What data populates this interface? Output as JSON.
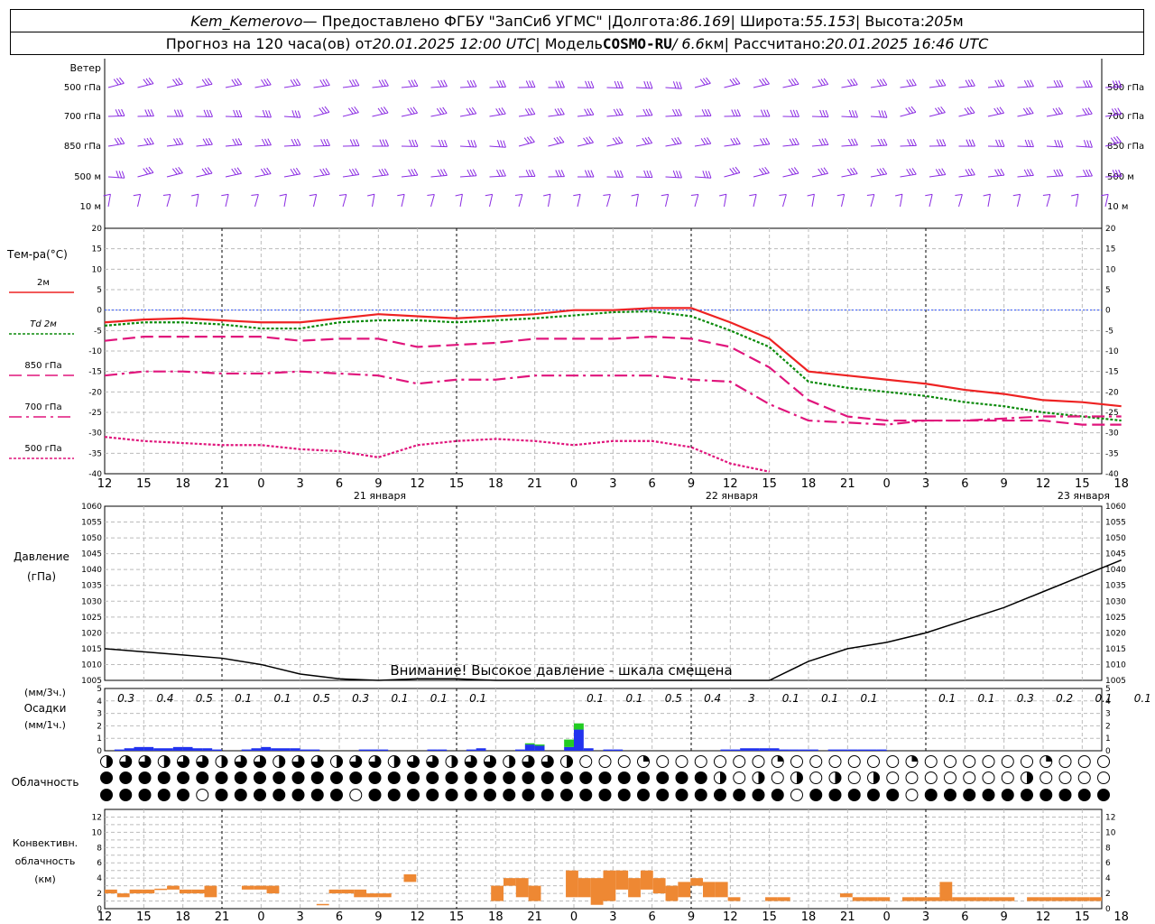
{
  "header": {
    "station": "Kem_Kemerovo",
    "provider": " — Предоставлено ФГБУ \"ЗапСиб УГМС\" | ",
    "lon_label": "Долгота: ",
    "lon": "86.169",
    "lat_label": " | Широта: ",
    "lat": "55.153",
    "alt_label": " | Высота: ",
    "alt": "205",
    "alt_unit": "м",
    "forecast_label": "Прогноз на 120 часа(ов) от ",
    "forecast_from": "20.01.2025 12:00 UTC",
    "model_label": " | Модель ",
    "model": "COSMO-RU",
    "res": " / 6.6",
    "res_unit": "км",
    "calc_label": " | Рассчитано: ",
    "calc": "20.01.2025 16:46 UTC"
  },
  "wind": {
    "title": "Ветер",
    "levels": [
      "500 гПа",
      "700 гПа",
      "850 гПа",
      "500 м",
      "10  м"
    ],
    "barb_color": "#8a2be2"
  },
  "temperature": {
    "title": "Тем-ра(°C)",
    "legend": [
      "2м",
      "Td  2м",
      "850 гПа",
      "700 гПа",
      "500 гПа"
    ],
    "colors": {
      "t2m": "#ee2222",
      "td": "#0a8a0a",
      "p850": "#e0157c",
      "p700": "#e0157c",
      "p500": "#e0157c",
      "zero": "#3355ff"
    },
    "yticks": [
      "20",
      "15",
      "10",
      "5",
      "0",
      "-5",
      "-10",
      "-15",
      "-20",
      "-25",
      "-30",
      "-35",
      "-40"
    ]
  },
  "time_axis": {
    "hours": [
      "12",
      "15",
      "18",
      "21",
      "0",
      "3",
      "6",
      "9",
      "12",
      "15",
      "18",
      "21",
      "0",
      "3",
      "6",
      "9",
      "12",
      "15",
      "18",
      "21",
      "0",
      "3",
      "6",
      "9",
      "12",
      "15",
      "18"
    ],
    "dates": [
      "21 января",
      "22 января",
      "23 января"
    ]
  },
  "pressure": {
    "title1": "Давление",
    "title2": "(гПа)",
    "warning": "Внимание! Высокое давление - шкала смещена",
    "yticks": [
      "1060",
      "1055",
      "1050",
      "1045",
      "1040",
      "1035",
      "1030",
      "1025",
      "1020",
      "1015",
      "1010",
      "1005"
    ]
  },
  "precip": {
    "label1": "(мм/3ч.)",
    "label2": "Осадки",
    "label3": "(мм/1ч.)",
    "yticks": [
      "5",
      "4",
      "3",
      "2",
      "1",
      "0"
    ],
    "three_hour": [
      "0.3",
      "0.4",
      "0.5",
      "0.1",
      "0.1",
      "0.5",
      "0.3",
      "0.1",
      "0.1",
      "0.1",
      "",
      "",
      "0.1",
      "0.1",
      "0.5",
      "0.4",
      "3",
      "0.1",
      "0.1",
      "0.1",
      "",
      "0.1",
      "0.1",
      "0.3",
      "0.2",
      "0.1",
      "0.1"
    ],
    "colors": {
      "snow": "#2233ee",
      "rain": "#22cc22"
    }
  },
  "cloud": {
    "title": "Облачность"
  },
  "convective": {
    "title1": "Конвективн.",
    "title2": "облачность",
    "title3": "(км)",
    "yticks": [
      "12",
      "10",
      "8",
      "6",
      "4",
      "2",
      "0"
    ],
    "color": "#ee8833"
  },
  "chart_data": [
    {
      "type": "line",
      "title": "Тем-ра(°C)",
      "x": [
        "12",
        "15",
        "18",
        "21",
        "0",
        "3",
        "6",
        "9",
        "12",
        "15",
        "18",
        "21",
        "0",
        "3",
        "6",
        "9",
        "12",
        "15",
        "18",
        "21",
        "0",
        "3",
        "6",
        "9",
        "12",
        "15",
        "18"
      ],
      "ylim": [
        -40,
        20
      ],
      "series": [
        {
          "name": "2м",
          "values": [
            -3,
            -2.3,
            -2,
            -2.5,
            -3,
            -3,
            -2,
            -1,
            -1.5,
            -2,
            -1.5,
            -1,
            0,
            0,
            0.5,
            0.5,
            -3,
            -7,
            -15,
            -16,
            -17,
            -18,
            -19.5,
            -20.5,
            -22,
            -22.5,
            -23.5
          ]
        },
        {
          "name": "Td  2м",
          "values": [
            -3.8,
            -3,
            -3,
            -3.5,
            -4.5,
            -4.5,
            -3,
            -2.5,
            -2.5,
            -3,
            -2.5,
            -2,
            -1.3,
            -0.5,
            -0.3,
            -1.5,
            -5,
            -9,
            -17.5,
            -19,
            -20,
            -21,
            -22.5,
            -23.5,
            -25,
            -26,
            -27
          ]
        },
        {
          "name": "850 гПа",
          "values": [
            -7.5,
            -6.5,
            -6.5,
            -6.5,
            -6.5,
            -7.5,
            -7,
            -7,
            -9,
            -8.5,
            -8,
            -7,
            -7,
            -7,
            -6.5,
            -7,
            -9,
            -14,
            -22,
            -26,
            -27,
            -27,
            -27,
            -27,
            -27,
            -28,
            -28
          ]
        },
        {
          "name": "700 гПа",
          "values": [
            -16,
            -15,
            -15,
            -15.5,
            -15.5,
            -15,
            -15.5,
            -16,
            -18,
            -17,
            -17,
            -16,
            -16,
            -16,
            -16,
            -17,
            -17.5,
            -23,
            -27,
            -27.5,
            -28,
            -27,
            -27,
            -26.5,
            -26,
            -26,
            -26
          ]
        },
        {
          "name": "500 гПа",
          "values": [
            -31,
            -32,
            -32.5,
            -33,
            -33,
            -34,
            -34.5,
            -36,
            -33,
            -32,
            -31.5,
            -32,
            -33,
            -32,
            -32,
            -33.5,
            -37.5,
            -39.5
          ]
        }
      ]
    },
    {
      "type": "line",
      "title": "Давление",
      "x": [
        "12",
        "15",
        "18",
        "21",
        "0",
        "3",
        "6",
        "9",
        "12",
        "15",
        "18",
        "21",
        "0",
        "3",
        "6",
        "9",
        "12",
        "15",
        "18",
        "21",
        "0",
        "3",
        "6",
        "9",
        "12",
        "15",
        "18"
      ],
      "ylim": [
        1005,
        1060
      ],
      "series": [
        {
          "name": "Давление",
          "values": [
            1015,
            1014,
            1013,
            1012,
            1010,
            1007,
            1005.5,
            1005,
            1005.5,
            1005.5,
            1005,
            1004.5,
            1002,
            1000,
            999,
            999,
            1000,
            1003,
            1011,
            1015,
            1017,
            1020,
            1024,
            1028,
            1033,
            1038,
            1043
          ]
        }
      ]
    },
    {
      "type": "bar",
      "title": "Осадки",
      "categories": [
        "12",
        "13",
        "14",
        "15",
        "16",
        "17",
        "18",
        "19",
        "20",
        "21",
        "22",
        "23",
        "0",
        "1",
        "2",
        "3",
        "4",
        "5",
        "6",
        "7",
        "8",
        "9",
        "10",
        "11",
        "12",
        "13",
        "14",
        "15",
        "16",
        "17",
        "18",
        "19",
        "20",
        "21",
        "22",
        "23",
        "0",
        "1",
        "2",
        "3",
        "4",
        "5",
        "6",
        "7",
        "8",
        "9",
        "10",
        "11",
        "12",
        "13",
        "14",
        "15",
        "16",
        "17",
        "18",
        "19",
        "20",
        "21",
        "22",
        "23",
        "0",
        "1",
        "2",
        "3",
        "4",
        "5",
        "6",
        "7",
        "8",
        "9",
        "10",
        "11",
        "12",
        "13",
        "14",
        "15",
        "16",
        "17",
        "18",
        "19"
      ],
      "ylim": [
        0,
        5
      ],
      "series": [
        {
          "name": "snow",
          "values": [
            0,
            0.1,
            0.2,
            0.3,
            0.3,
            0.2,
            0.2,
            0.3,
            0.3,
            0.2,
            0.2,
            0.1,
            0,
            0,
            0.1,
            0.2,
            0.3,
            0.2,
            0.2,
            0.2,
            0.1,
            0.1,
            0,
            0,
            0,
            0,
            0.1,
            0.1,
            0.1,
            0,
            0,
            0,
            0,
            0.1,
            0.1,
            0,
            0,
            0.1,
            0.2,
            0,
            0,
            0,
            0.1,
            0.5,
            0.4,
            0,
            0,
            0.3,
            1.7,
            0.2,
            0,
            0.1,
            0.1,
            0,
            0,
            0,
            0,
            0,
            0,
            0,
            0,
            0,
            0,
            0.1,
            0.1,
            0.2,
            0.2,
            0.2,
            0.2,
            0.1,
            0.1,
            0.1,
            0.1,
            0,
            0.1,
            0.1,
            0.1,
            0.1,
            0.1,
            0.1
          ]
        },
        {
          "name": "rain",
          "values": [
            0,
            0,
            0,
            0,
            0,
            0,
            0,
            0,
            0,
            0,
            0,
            0,
            0,
            0,
            0,
            0,
            0,
            0,
            0,
            0,
            0,
            0,
            0,
            0,
            0,
            0,
            0,
            0,
            0,
            0,
            0,
            0,
            0,
            0,
            0,
            0,
            0,
            0,
            0,
            0,
            0,
            0,
            0,
            0.1,
            0.1,
            0,
            0,
            0.6,
            0.5,
            0,
            0,
            0,
            0,
            0,
            0,
            0,
            0,
            0,
            0,
            0,
            0,
            0,
            0,
            0,
            0,
            0,
            0,
            0,
            0,
            0,
            0,
            0,
            0,
            0,
            0,
            0,
            0,
            0,
            0,
            0
          ]
        }
      ]
    },
    {
      "type": "bar",
      "title": "Конвективн. облачность",
      "ylim": [
        0,
        13
      ],
      "series": [
        {
          "name": "low",
          "values": [
            2,
            1.5,
            2,
            2,
            2.5,
            2.5,
            2,
            2,
            1.5,
            0,
            0,
            2.5,
            2.5,
            2,
            0,
            0,
            0,
            0.5,
            2,
            2,
            1.5,
            1.5,
            1.5,
            0,
            3.5,
            0,
            0,
            0,
            0,
            0,
            0,
            1,
            3,
            1.5,
            1,
            0,
            0,
            1.5,
            1.5,
            0.5,
            1,
            2.5,
            1.5,
            2.5,
            2,
            1,
            1.5,
            3,
            1.5,
            1.5,
            1,
            0,
            0,
            1,
            1,
            0,
            0,
            0,
            0,
            1.5,
            1,
            1,
            1,
            0,
            1,
            1,
            1,
            1,
            1,
            1,
            1,
            1,
            1,
            0,
            1,
            1,
            1,
            1,
            1,
            1
          ]
        },
        {
          "name": "high",
          "values": [
            2.5,
            2,
            2.5,
            2.5,
            2.5,
            3,
            2.5,
            2.5,
            3,
            0,
            0,
            3,
            3,
            3,
            0,
            0,
            0,
            0.5,
            2.5,
            2.5,
            2.5,
            2,
            2,
            0,
            4.5,
            0,
            0,
            0,
            0,
            0,
            0,
            3,
            4,
            4,
            3,
            0,
            0,
            5,
            4,
            4,
            5,
            5,
            4,
            5,
            4,
            3,
            3.5,
            4,
            3.5,
            3.5,
            1.5,
            0,
            0,
            1.5,
            1.5,
            0,
            0,
            0,
            0,
            2,
            1.5,
            1.5,
            1.5,
            0,
            1.5,
            1.5,
            1.5,
            3.5,
            1.5,
            1.5,
            1.5,
            1.5,
            1.5,
            0,
            1.5,
            1.5,
            1.5,
            1.5,
            1.5,
            1.5
          ]
        }
      ]
    }
  ]
}
